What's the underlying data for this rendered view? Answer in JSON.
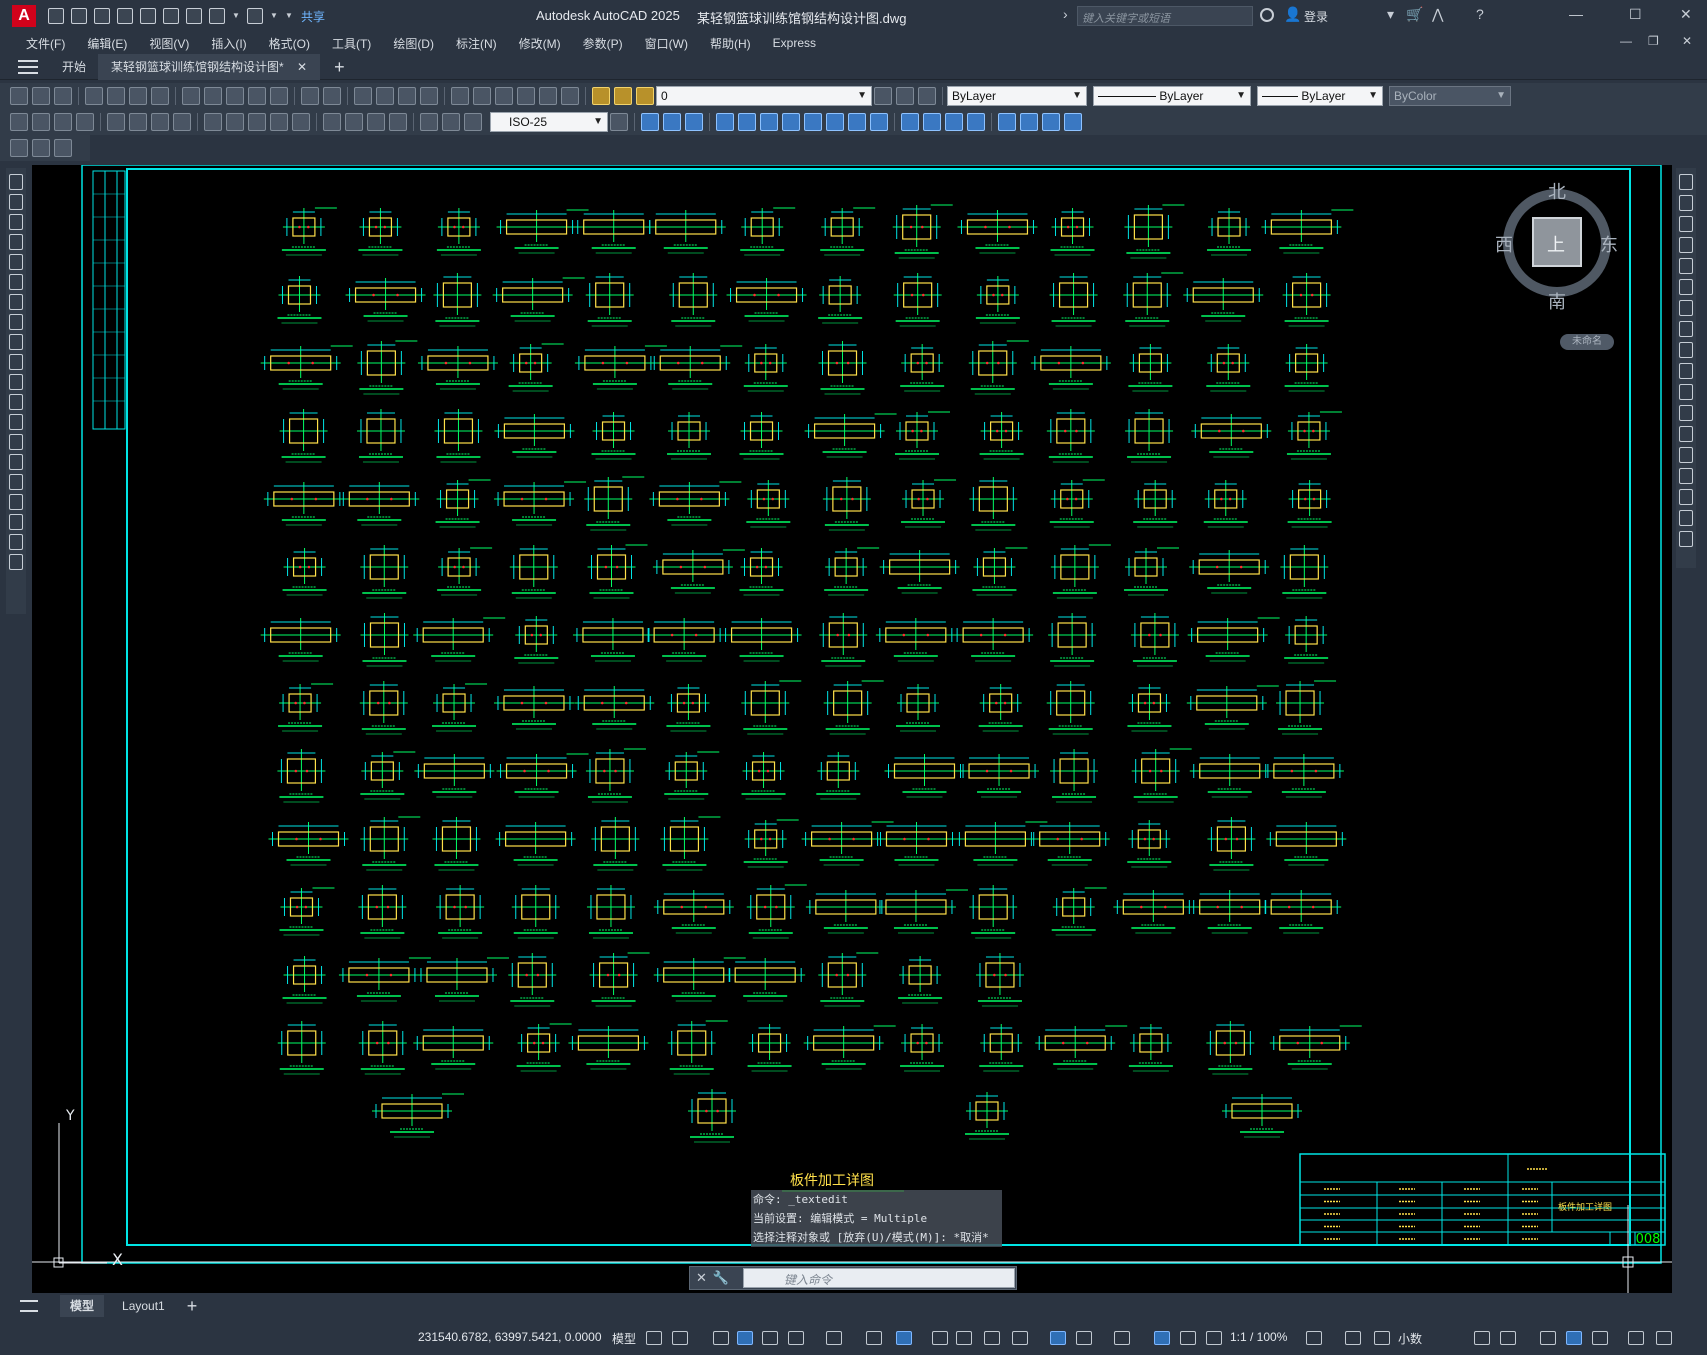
{
  "app": {
    "logo_letter": "A",
    "share_label": "共享",
    "title": "Autodesk AutoCAD 2025",
    "file_title": "某轻钢篮球训练馆钢结构设计图.dwg",
    "search_placeholder": "键入关键字或短语",
    "login_label": "登录"
  },
  "menu": {
    "items": [
      "文件(F)",
      "编辑(E)",
      "视图(V)",
      "插入(I)",
      "格式(O)",
      "工具(T)",
      "绘图(D)",
      "标注(N)",
      "修改(M)",
      "参数(P)",
      "窗口(W)",
      "帮助(H)",
      "Express"
    ]
  },
  "file_tabs": {
    "start": "开始",
    "active": "某轻钢篮球训练馆钢结构设计图*"
  },
  "toolbar": {
    "layer_value": "0",
    "color_value": "ByLayer",
    "linetype_value": "ByLayer",
    "lineweight_value": "ByLayer",
    "plotstyle_value": "ByColor",
    "dimstyle_value": "ISO-25"
  },
  "viewcube": {
    "north": "北",
    "south": "南",
    "east": "东",
    "west": "西",
    "top_face": "上",
    "wcs": "未命名"
  },
  "drawing": {
    "sheet_title": "板件加工详图",
    "title_block_name": "板件加工详图",
    "sheet_no": "008",
    "part_rows": 14,
    "parts_per_row": [
      14,
      14,
      14,
      14,
      14,
      14,
      14,
      14,
      14,
      14,
      14,
      10,
      14,
      4
    ],
    "ucs_y": "Y",
    "ucs_x": "X"
  },
  "command": {
    "history": [
      "命令: _textedit",
      "当前设置: 编辑模式 = Multiple",
      "选择注释对象或 [放弃(U)/模式(M)]: *取消*"
    ],
    "input_placeholder": "键入命令"
  },
  "layout_tabs": [
    "模型",
    "Layout1"
  ],
  "status": {
    "coords": "231540.6782, 63997.5421, 0.0000",
    "model": "模型",
    "scale": "1:1 / 100%",
    "units": "小数"
  }
}
